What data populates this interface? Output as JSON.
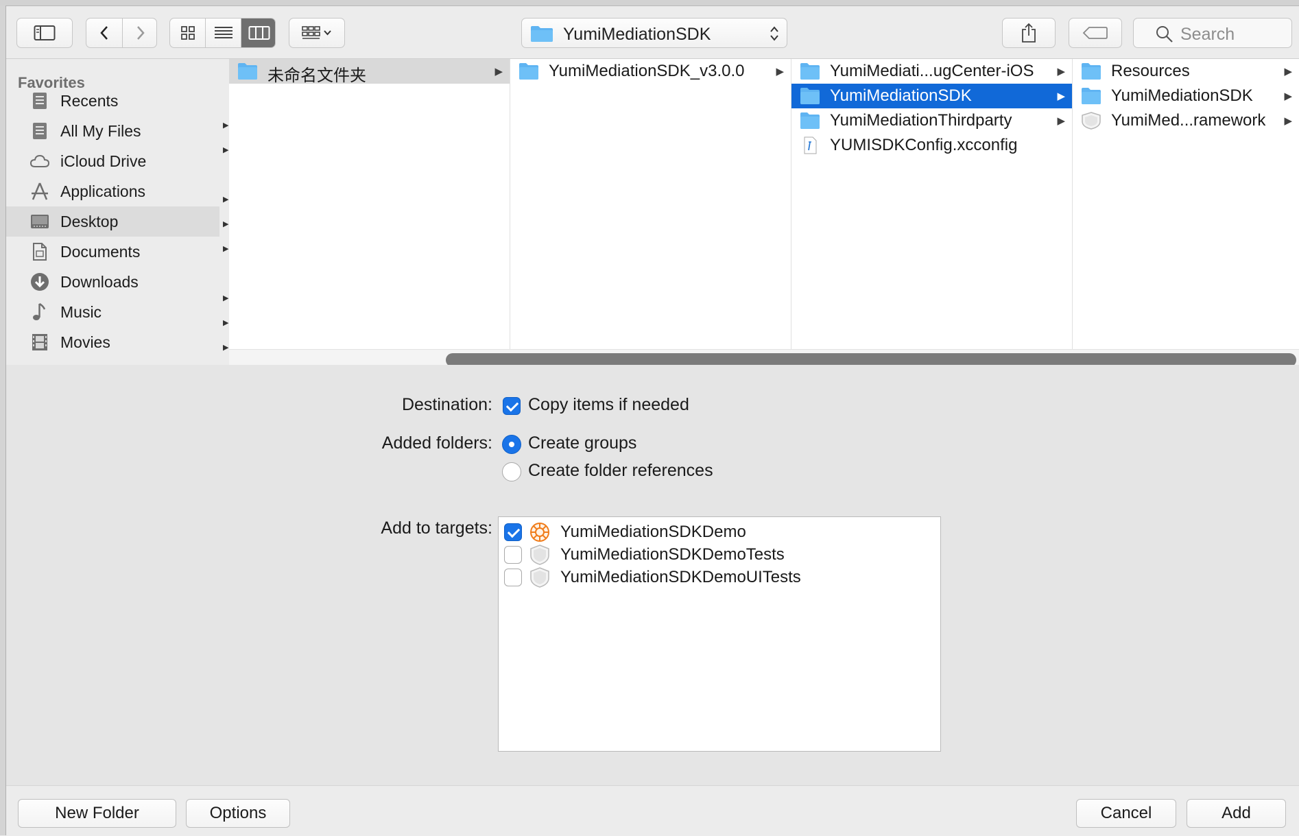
{
  "toolbar": {
    "path_label": "YumiMediationSDK",
    "search_placeholder": "Search"
  },
  "sidebar": {
    "heading": "Favorites",
    "items": [
      {
        "label": "Recents",
        "icon": "recents-icon"
      },
      {
        "label": "All My Files",
        "icon": "all-files-icon"
      },
      {
        "label": "iCloud Drive",
        "icon": "cloud-icon"
      },
      {
        "label": "Applications",
        "icon": "applications-icon"
      },
      {
        "label": "Desktop",
        "icon": "desktop-icon",
        "selected": true
      },
      {
        "label": "Documents",
        "icon": "documents-icon"
      },
      {
        "label": "Downloads",
        "icon": "downloads-icon"
      },
      {
        "label": "Music",
        "icon": "music-icon"
      },
      {
        "label": "Movies",
        "icon": "movies-icon"
      }
    ]
  },
  "browser": {
    "col1": [
      {
        "label": "未命名文件夹",
        "type": "folder",
        "state": "path"
      }
    ],
    "col2": [
      {
        "label": "YumiMediationSDK_v3.0.0",
        "type": "folder"
      }
    ],
    "col3": [
      {
        "label": "YumiMediati...ugCenter-iOS",
        "type": "folder"
      },
      {
        "label": "YumiMediationSDK",
        "type": "folder",
        "state": "selected"
      },
      {
        "label": "YumiMediationThirdparty",
        "type": "folder"
      },
      {
        "label": "YUMISDKConfig.xcconfig",
        "type": "file"
      }
    ],
    "col4": [
      {
        "label": "Resources",
        "type": "folder"
      },
      {
        "label": "YumiMediationSDK",
        "type": "folder"
      },
      {
        "label": "YumiMed...ramework",
        "type": "framework"
      }
    ]
  },
  "options": {
    "destination_label": "Destination:",
    "copy_items_label": "Copy items if needed",
    "copy_items_checked": true,
    "added_folders_label": "Added folders:",
    "create_groups_label": "Create groups",
    "create_refs_label": "Create folder references",
    "selected_folder_mode": "Create groups",
    "targets_label": "Add to targets:",
    "targets": [
      {
        "label": "YumiMediationSDKDemo",
        "checked": true,
        "icon": "app-target-icon"
      },
      {
        "label": "YumiMediationSDKDemoTests",
        "checked": false,
        "icon": "test-target-icon"
      },
      {
        "label": "YumiMediationSDKDemoUITests",
        "checked": false,
        "icon": "test-target-icon"
      }
    ]
  },
  "footer": {
    "new_folder": "New Folder",
    "options": "Options",
    "cancel": "Cancel",
    "add": "Add"
  },
  "colors": {
    "accent": "#1a74e8",
    "selection": "#1169d8",
    "folder": "#5fb4f2"
  }
}
